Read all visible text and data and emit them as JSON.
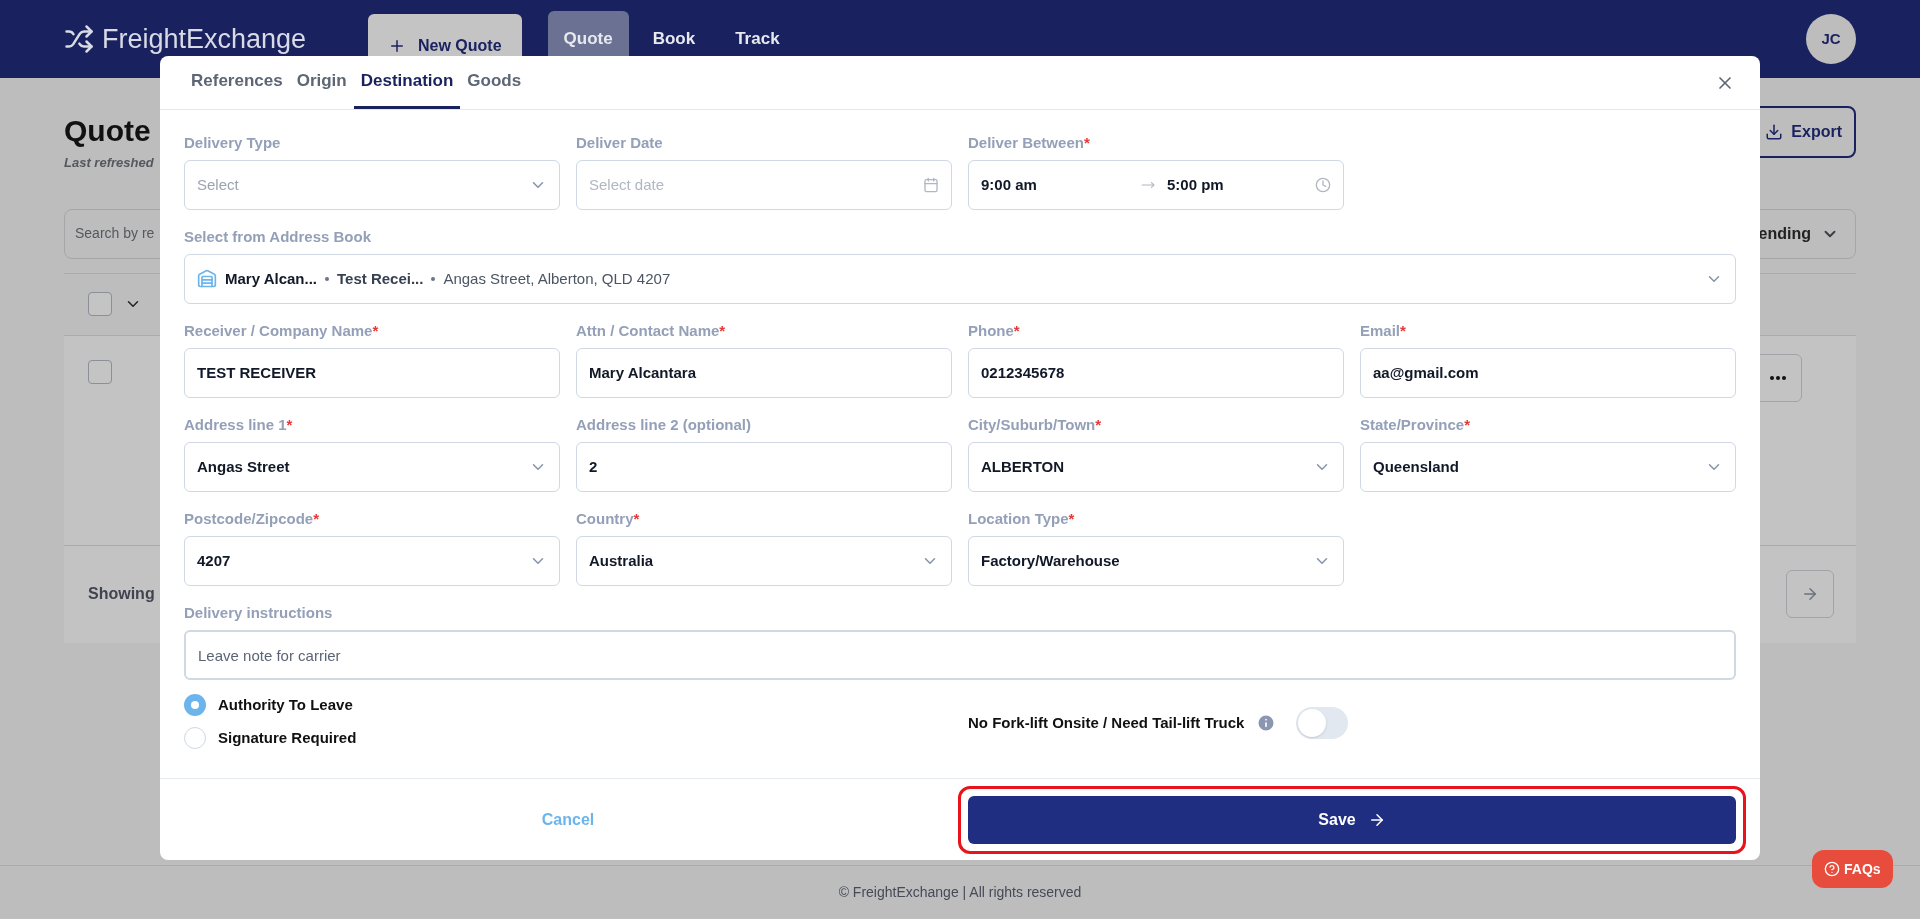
{
  "header": {
    "logo": "FreightExchange",
    "new_quote": "New Quote",
    "nav": [
      {
        "label": "Quote",
        "selected": true
      },
      {
        "label": "Book",
        "selected": false
      },
      {
        "label": "Track",
        "selected": false
      }
    ],
    "avatar": "JC"
  },
  "background": {
    "title": "Quote",
    "subtitle": "Last refreshed",
    "search_placeholder": "Search by re",
    "export": "Export",
    "sort": "ending",
    "showing": "Showing",
    "checkboxes": [
      {
        "checked": false
      },
      {
        "checked": false
      }
    ]
  },
  "modal": {
    "tabs": [
      {
        "label": "References",
        "selected": false
      },
      {
        "label": "Origin",
        "selected": false
      },
      {
        "label": "Destination",
        "selected": true
      },
      {
        "label": "Goods",
        "selected": false
      }
    ],
    "rows": [
      [
        {
          "kind": "select",
          "label": "Delivery Type",
          "placeholder": "Select"
        },
        {
          "kind": "date",
          "label": "Deliver Date",
          "placeholder": "Select date"
        },
        {
          "kind": "time_range",
          "label": "Deliver Between",
          "required_mark": "*",
          "start": "9:00 am",
          "end": "5:00 pm"
        }
      ],
      [
        {
          "kind": "address",
          "label": "Select from Address Book",
          "name": "Mary Alcan...",
          "company": "Test Recei...",
          "address": "Angas Street, Alberton, QLD 4207"
        }
      ],
      [
        {
          "kind": "text",
          "label": "Receiver / Company Name",
          "required_mark": "*",
          "value": "TEST RECEIVER"
        },
        {
          "kind": "text",
          "label": "Attn / Contact Name",
          "required_mark": "*",
          "value": "Mary Alcantara"
        },
        {
          "kind": "text",
          "label": "Phone",
          "required_mark": "*",
          "value": "0212345678"
        },
        {
          "kind": "text",
          "label": "Email",
          "required_mark": "*",
          "value": "aa@gmail.com"
        }
      ],
      [
        {
          "kind": "select",
          "label": "Address line 1",
          "required_mark": "*",
          "value": "Angas Street"
        },
        {
          "kind": "text",
          "label": "Address line 2 (optional)",
          "value": "2"
        },
        {
          "kind": "select",
          "label": "City/Suburb/Town",
          "required_mark": "*",
          "value": "ALBERTON"
        },
        {
          "kind": "select",
          "label": "State/Province",
          "required_mark": "*",
          "value": "Queensland"
        }
      ],
      [
        {
          "kind": "select",
          "label": "Postcode/Zipcode",
          "required_mark": "*",
          "value": "4207"
        },
        {
          "kind": "select",
          "label": "Country",
          "required_mark": "*",
          "value": "Australia"
        },
        {
          "kind": "select",
          "label": "Location Type",
          "required_mark": "*",
          "value": "Factory/Warehouse"
        }
      ],
      [
        {
          "kind": "textarea",
          "label": "Delivery instructions",
          "placeholder": "Leave note for carrier"
        }
      ]
    ],
    "radios": [
      {
        "label": "Authority To Leave",
        "selected": true
      },
      {
        "label": "Signature Required",
        "selected": false
      }
    ],
    "toggle": {
      "label": "No Fork-lift Onsite / Need Tail-lift Truck",
      "on": false
    },
    "cancel": "Cancel",
    "save": {
      "label": "Save",
      "highlighted": true
    }
  },
  "footer": "© FreightExchange | All rights reserved",
  "faqs": "FAQs"
}
